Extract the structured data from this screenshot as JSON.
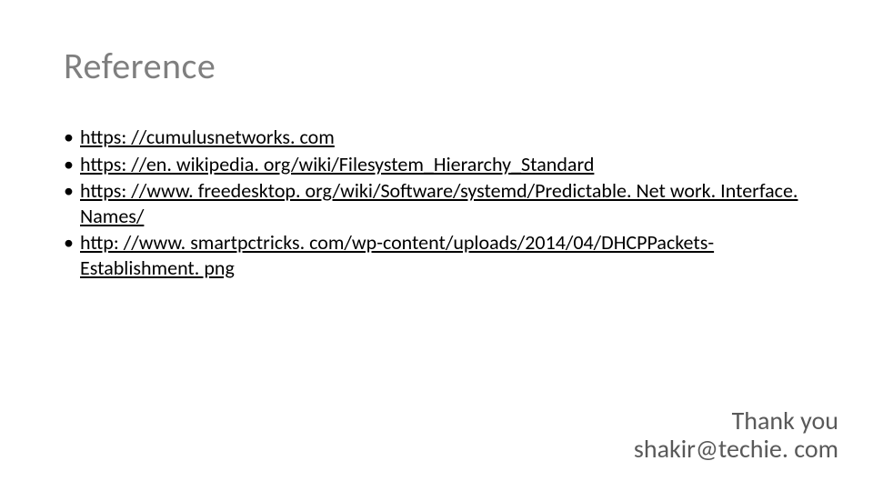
{
  "title": "Reference",
  "refs": [
    "https: //cumulusnetworks. com",
    "https: //en. wikipedia. org/wiki/Filesystem_Hierarchy_Standard",
    "https: //www. freedesktop. org/wiki/Software/systemd/Predictable. Net work. Interface. Names/",
    "http: //www. smartpctricks. com/wp-content/uploads/2014/04/DHCPPackets-Establishment. png"
  ],
  "footer": {
    "line1": "Thank you",
    "line2": "shakir@techie. com"
  }
}
